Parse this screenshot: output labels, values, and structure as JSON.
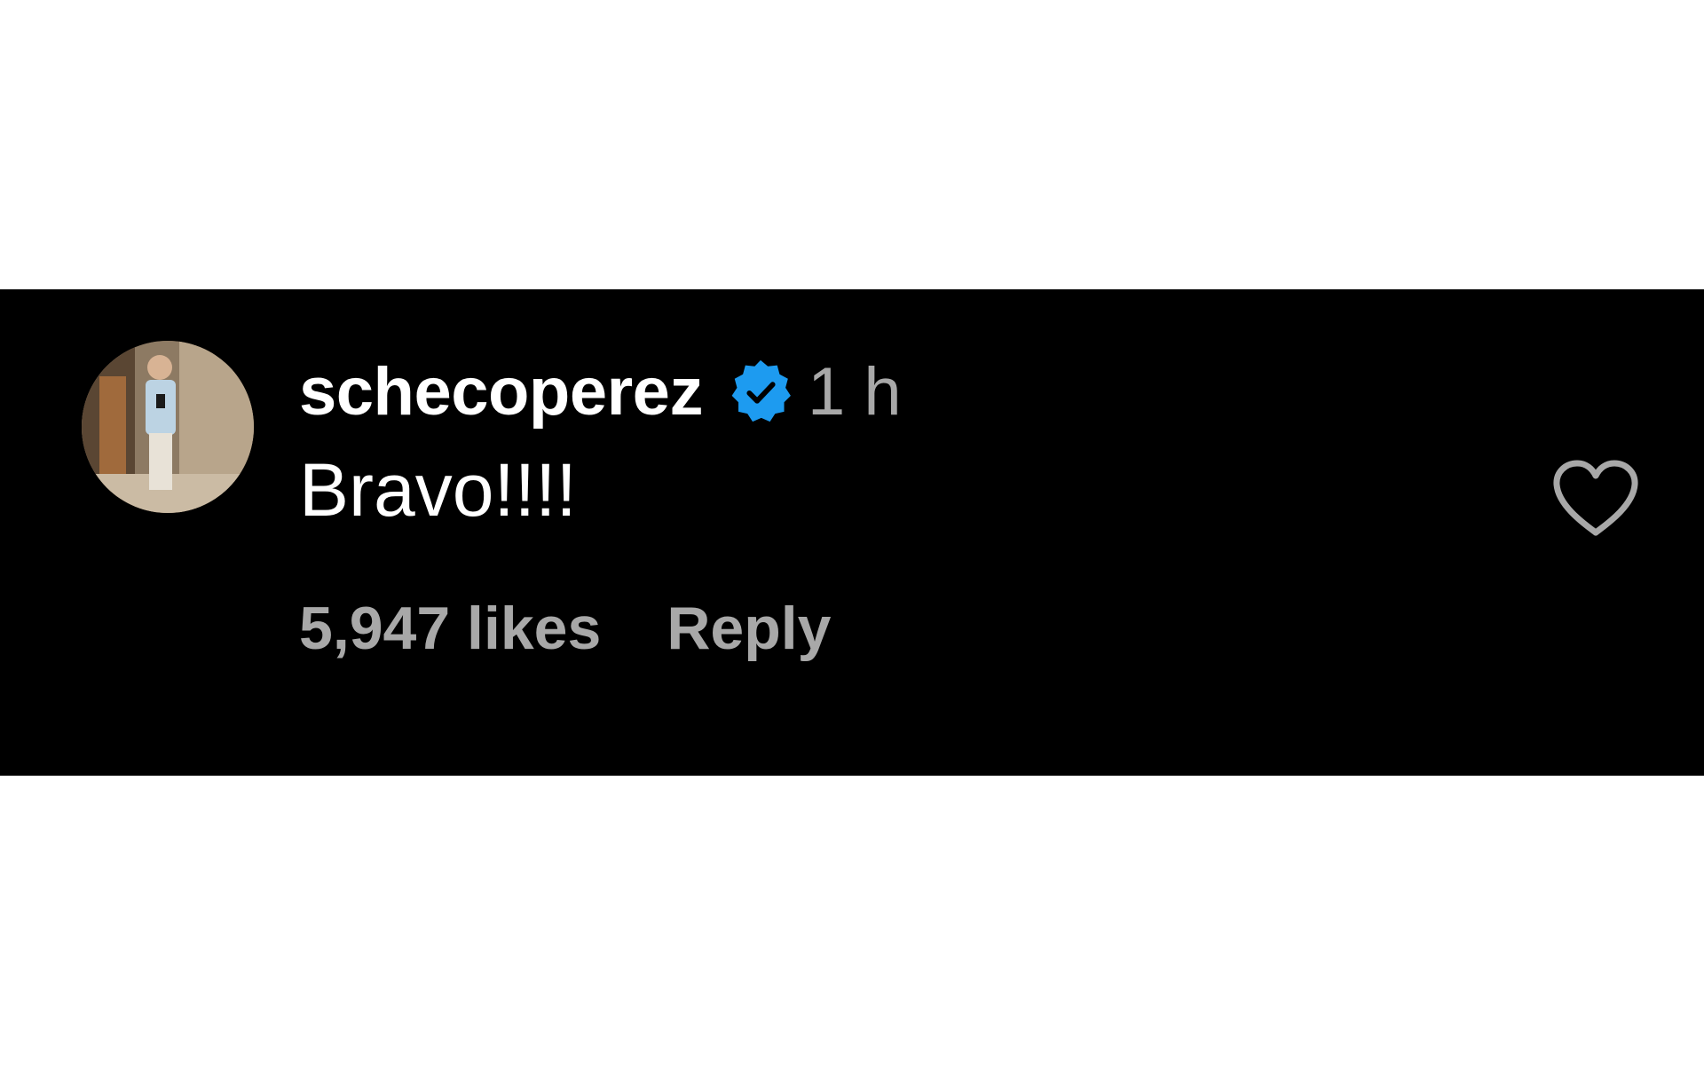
{
  "comment": {
    "username": "schecoperez",
    "verified_icon": "verified-badge-icon",
    "timestamp": "1 h",
    "text": "Bravo!!!!",
    "likes": "5,947 likes",
    "reply_label": "Reply",
    "like_icon": "heart-outline-icon"
  },
  "colors": {
    "background": "#ffffff",
    "band": "#000000",
    "primary_text": "#ffffff",
    "secondary_text": "#a8a8a8",
    "verified_blue": "#1d9bf0"
  }
}
